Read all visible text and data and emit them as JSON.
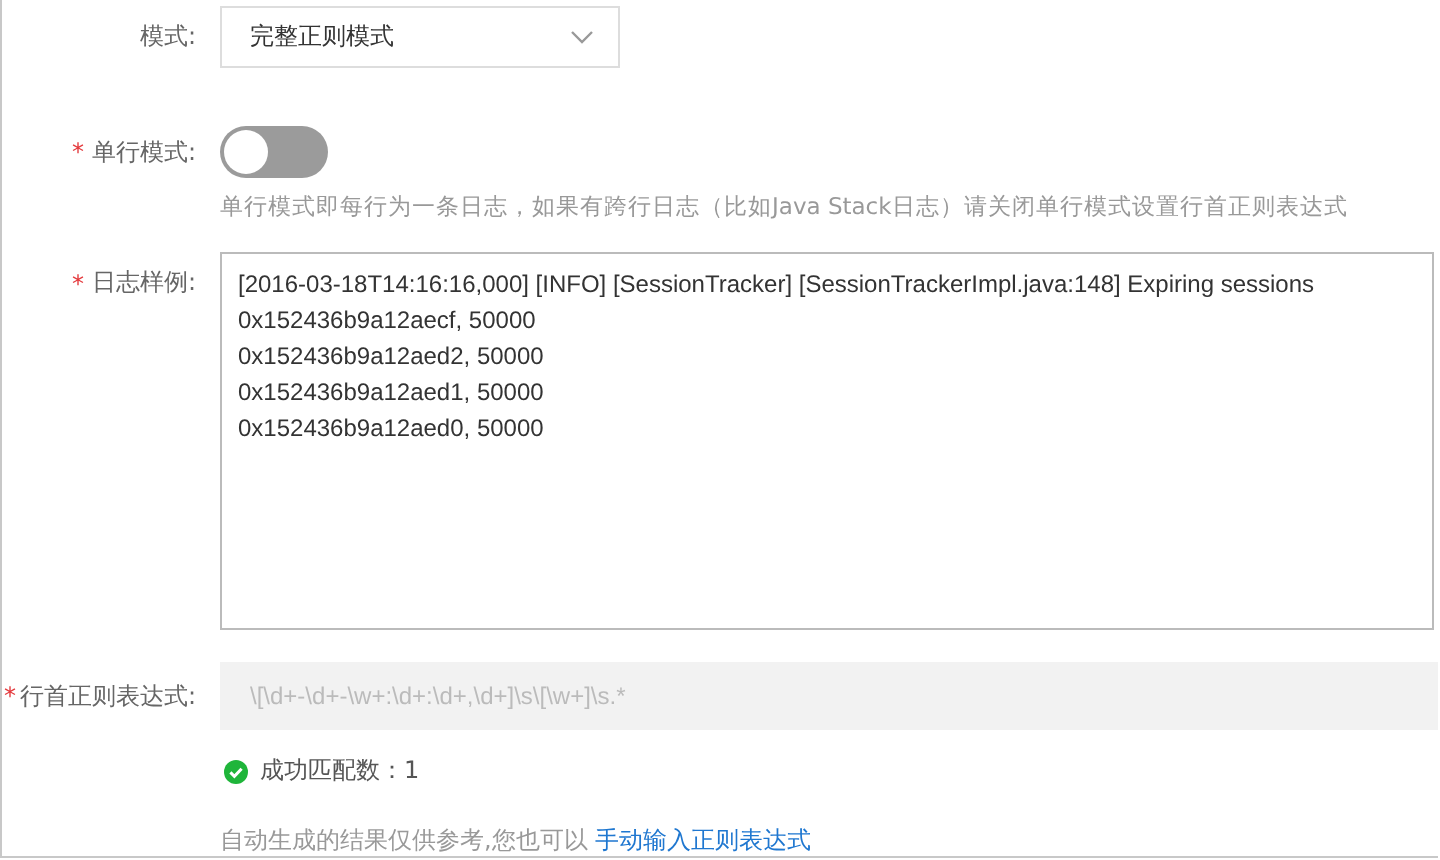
{
  "mode": {
    "label": "模式:",
    "value": "完整正则模式"
  },
  "single_line": {
    "marker": "*",
    "label": "单行模式:",
    "on": false,
    "help": "单行模式即每行为一条日志，如果有跨行日志（比如Java Stack日志）请关闭单行模式设置行首正则表达式"
  },
  "log_sample": {
    "marker": "*",
    "label": "日志样例:",
    "lines": [
      "[2016-03-18T14:16:16,000] [INFO] [SessionTracker] [SessionTrackerImpl.java:148] Expiring sessions",
      "0x152436b9a12aecf, 50000",
      "0x152436b9a12aed2, 50000",
      "0x152436b9a12aed1, 50000",
      "0x152436b9a12aed0, 50000"
    ]
  },
  "line_regex": {
    "marker": "*",
    "label": "行首正则表达式:",
    "value": "\\[\\d+-\\d+-\\w+:\\d+:\\d+,\\d+]\\s\\[\\w+]\\s.*",
    "disabled": true
  },
  "match_result": {
    "text": "成功匹配数：1"
  },
  "footer": {
    "text": "自动生成的结果仅供参考,您也可以",
    "link": "手动输入正则表达式"
  }
}
